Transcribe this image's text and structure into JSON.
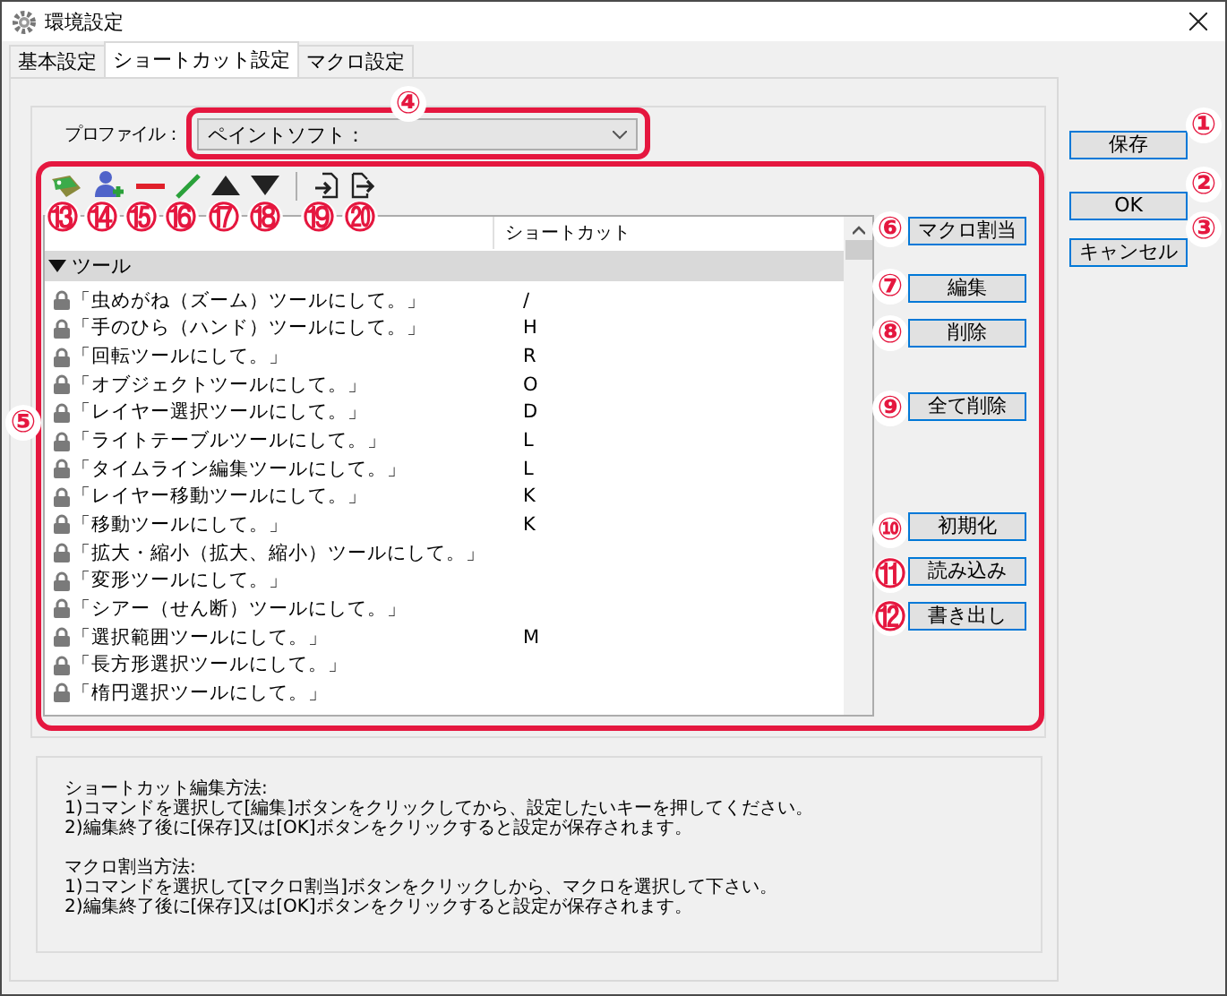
{
  "window": {
    "title": "環境設定"
  },
  "tabs": [
    {
      "label": "基本設定",
      "selected": false
    },
    {
      "label": "ショートカット設定",
      "selected": true
    },
    {
      "label": "マクロ設定",
      "selected": false
    }
  ],
  "profile": {
    "label": "プロファイル：",
    "value": "ペイントソフト："
  },
  "list": {
    "shortcut_heading": "ショートカット",
    "group": {
      "label": "ツール",
      "expanded": true
    },
    "rows": [
      {
        "command": "「虫めがね（ズーム）ツールにして。」",
        "shortcut": "/",
        "locked": true
      },
      {
        "command": "「手のひら（ハンド）ツールにして。」",
        "shortcut": "H",
        "locked": true
      },
      {
        "command": "「回転ツールにして。」",
        "shortcut": "R",
        "locked": true
      },
      {
        "command": "「オブジェクトツールにして。」",
        "shortcut": "O",
        "locked": true
      },
      {
        "command": "「レイヤー選択ツールにして。」",
        "shortcut": "D",
        "locked": true
      },
      {
        "command": "「ライトテーブルツールにして。」",
        "shortcut": "L",
        "locked": true
      },
      {
        "command": "「タイムライン編集ツールにして。」",
        "shortcut": "L",
        "locked": true
      },
      {
        "command": "「レイヤー移動ツールにして。」",
        "shortcut": "K",
        "locked": true
      },
      {
        "command": "「移動ツールにして。」",
        "shortcut": "K",
        "locked": true
      },
      {
        "command": "「拡大・縮小（拡大、縮小）ツールにして。」",
        "shortcut": "",
        "locked": true
      },
      {
        "command": "「変形ツールにして。」",
        "shortcut": "",
        "locked": true
      },
      {
        "command": "「シアー（せん断）ツールにして。」",
        "shortcut": "",
        "locked": true
      },
      {
        "command": "「選択範囲ツールにして。」",
        "shortcut": "M",
        "locked": true
      },
      {
        "command": "「長方形選択ツールにして。」",
        "shortcut": "",
        "locked": true
      },
      {
        "command": "「楕円選択ツールにして。」",
        "shortcut": "",
        "locked": true
      }
    ]
  },
  "action_buttons": [
    "マクロ割当",
    "編集",
    "削除",
    "全て削除",
    "初期化",
    "読み込み",
    "書き出し"
  ],
  "dialog_buttons": [
    "保存",
    "OK",
    "キャンセル"
  ],
  "help": [
    {
      "heading": "ショートカット編集方法:",
      "lines": [
        "1)コマンドを選択して[編集]ボタンをクリックしてから、設定したいキーを押してください。",
        "2)編集終了後に[保存]又は[OK]ボタンをクリックすると設定が保存されます。"
      ]
    },
    {
      "heading": "マクロ割当方法:",
      "lines": [
        "1)コマンドを選択して[マクロ割当]ボタンをクリックしから、マクロを選択して下さい。",
        "2)編集終了後に[保存]又は[OK]ボタンをクリックすると設定が保存されます。"
      ]
    }
  ],
  "callouts": [
    "①",
    "②",
    "③",
    "④",
    "⑤",
    "⑥",
    "⑦",
    "⑧",
    "⑨",
    "⑩",
    "⑪",
    "⑫",
    "⑬",
    "⑭",
    "⑮",
    "⑯",
    "⑰",
    "⑱",
    "⑲",
    "⑳"
  ]
}
